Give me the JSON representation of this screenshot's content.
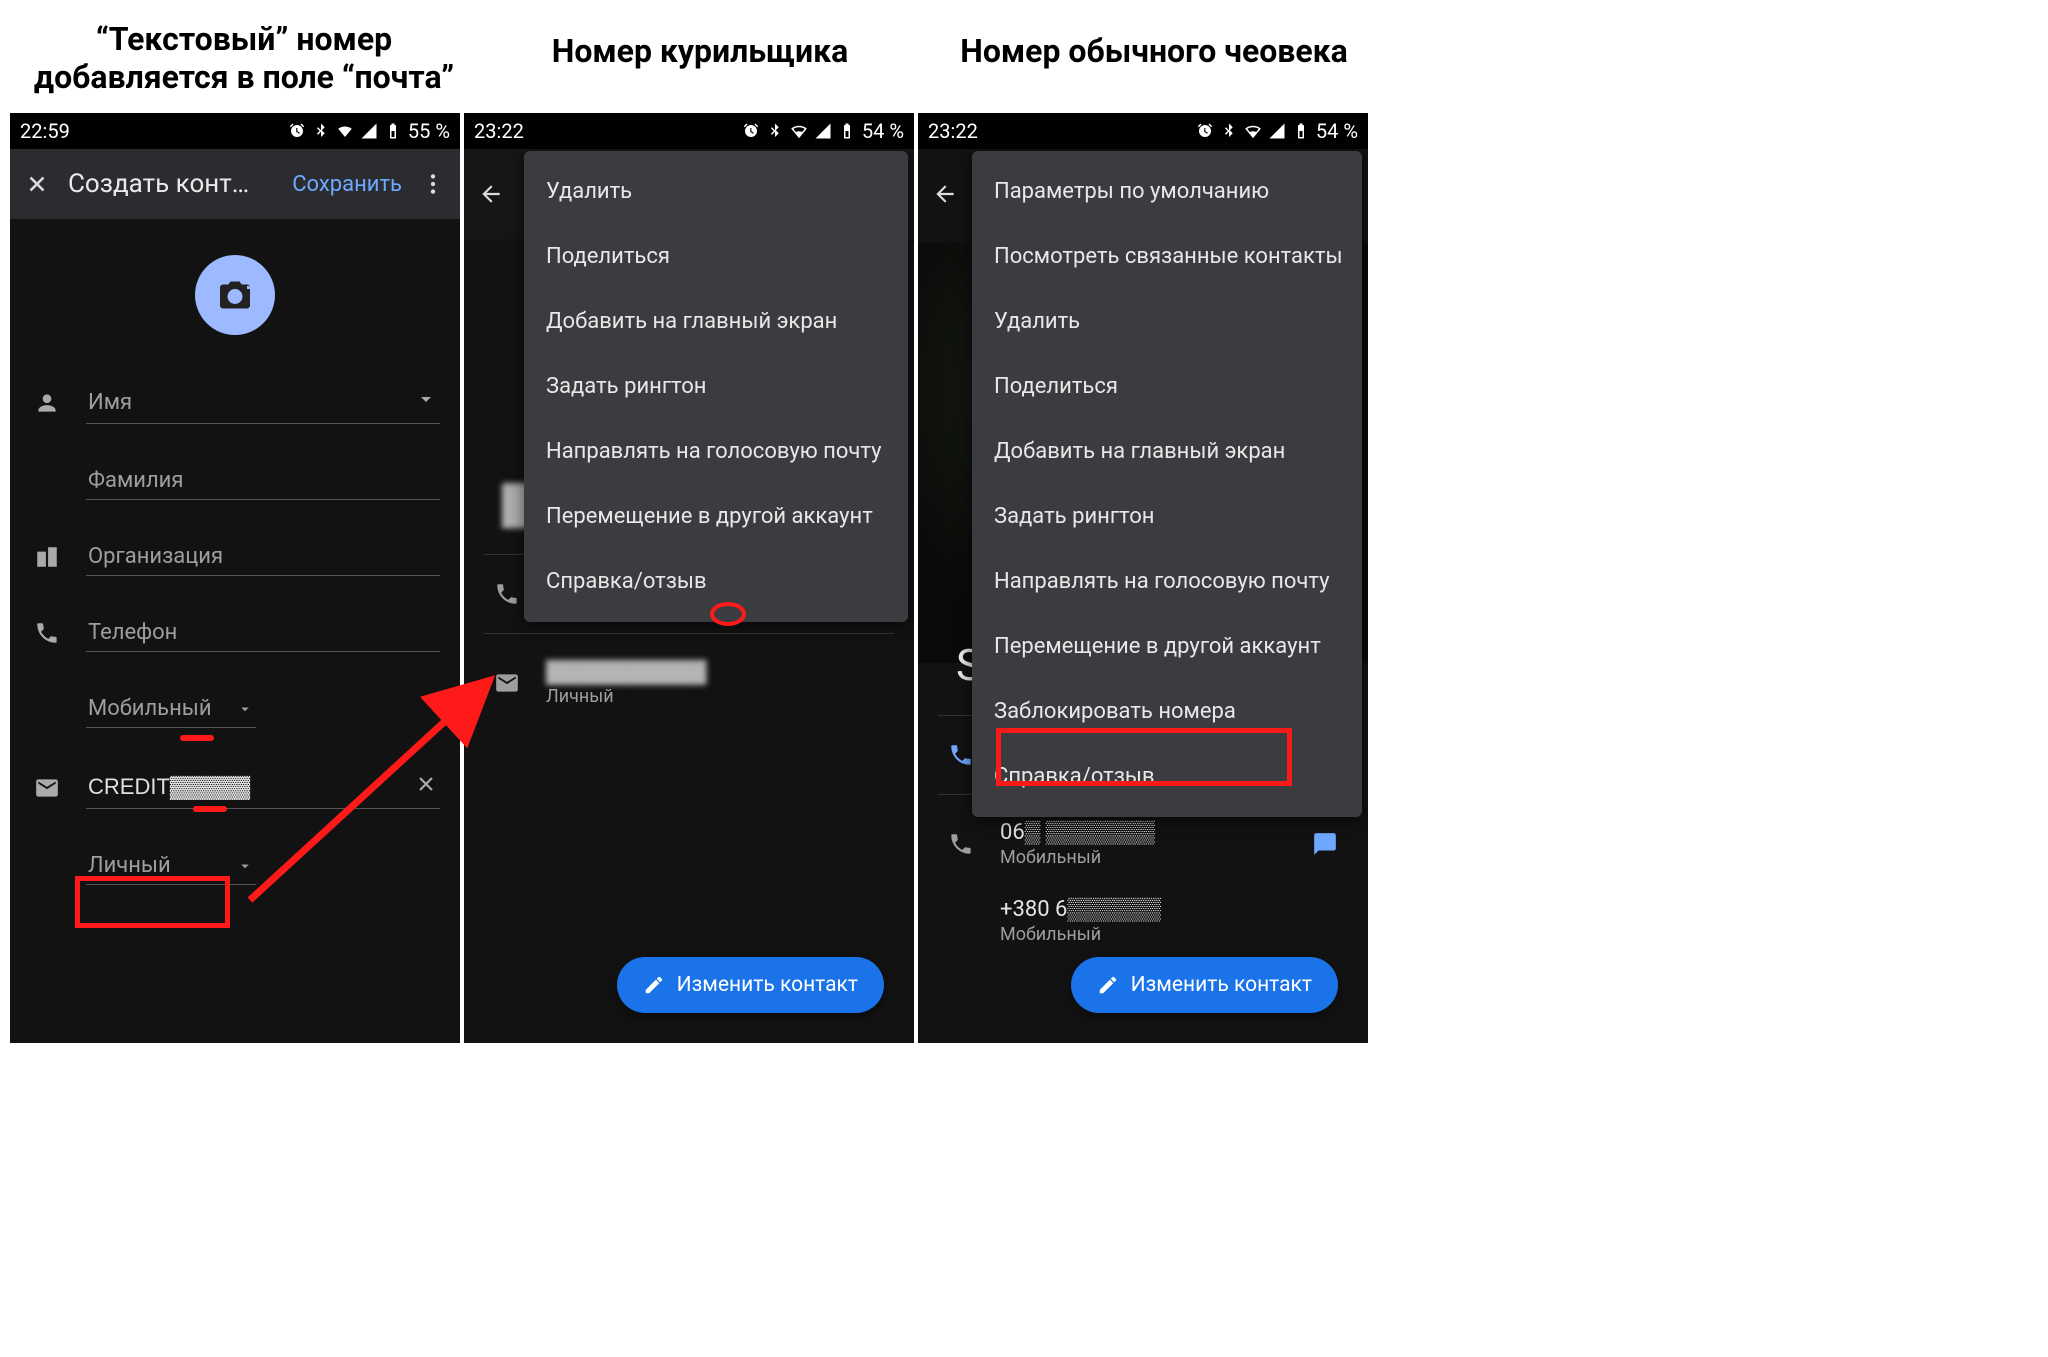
{
  "captions": {
    "c1_line1": "“Текстовый” номер",
    "c1_line2": "добавляется в поле “почта”",
    "c2": "Номер курильщика",
    "c3": "Номер обычного чеовека"
  },
  "status": {
    "time1": "22:59",
    "time2": "23:22",
    "time3": "23:22",
    "battery1": "55 %",
    "battery2": "54 %",
    "battery3": "54 %"
  },
  "screen1": {
    "title": "Создать конт…",
    "save": "Сохранить",
    "fields": {
      "name": "Имя",
      "surname": "Фамилия",
      "org": "Организация",
      "phone": "Телефон",
      "phone_type": "Мобильный",
      "email_value": "CREDIT▓▓▓▓▓",
      "email_type": "Личный"
    }
  },
  "screen2": {
    "menu": [
      "Удалить",
      "Поделиться",
      "Добавить на главный экран",
      "Задать рингтон",
      "Направлять на голосовую почту",
      "Перемещение в другой аккаунт",
      "Справка/отзыв"
    ],
    "call": "Вызов",
    "email_type": "Личный",
    "fab": "Изменить контакт"
  },
  "screen3": {
    "menu": [
      "Параметры по умолчанию",
      "Посмотреть связанные контакты",
      "Удалить",
      "Поделиться",
      "Добавить на главный экран",
      "Задать рингтон",
      "Направлять на голосовую почту",
      "Перемещение в другой аккаунт",
      "Заблокировать номера",
      "Справка/отзыв"
    ],
    "name_initial": "S",
    "call": "Вызов",
    "number1": "06▒ ▒▒▒▒▒▒▒",
    "type1": "Мобильный",
    "number2": "+380 6▒▒▒▒▒▒",
    "type2": "Мобильный",
    "fab": "Изменить контакт"
  }
}
